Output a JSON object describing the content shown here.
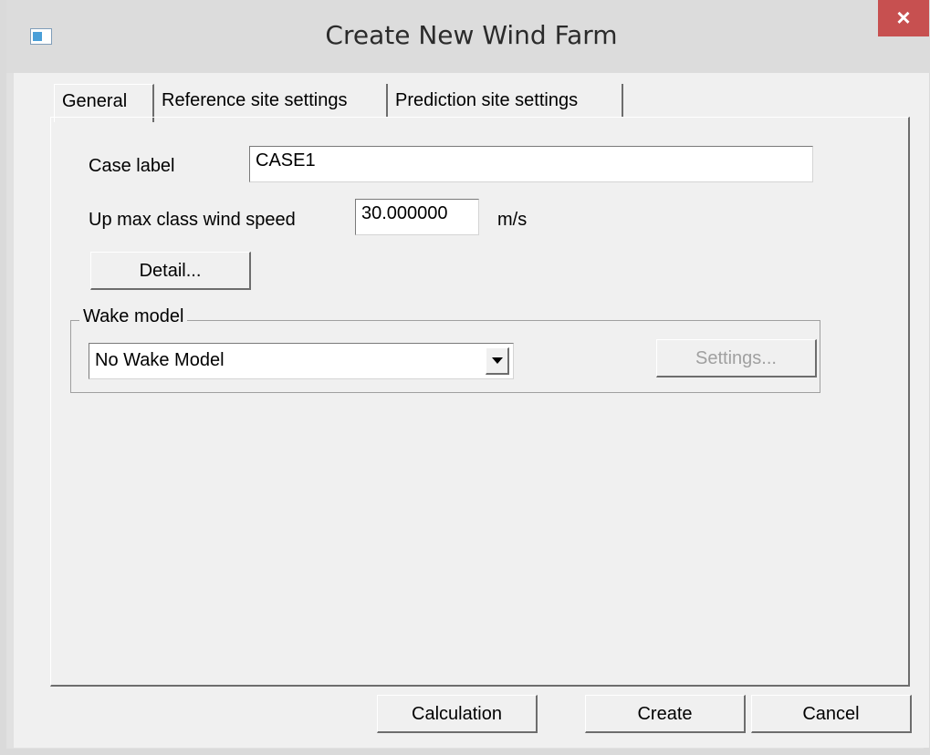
{
  "window": {
    "title": "Create New Wind Farm",
    "close_label": "×",
    "icon": "app-window-icon"
  },
  "tabs": [
    {
      "label": "General",
      "active": true
    },
    {
      "label": "Reference site settings",
      "active": false
    },
    {
      "label": "Prediction site settings",
      "active": false
    }
  ],
  "general": {
    "case_label": {
      "label": "Case label",
      "value": "CASE1"
    },
    "max_wind_speed": {
      "label": "Up max class wind speed",
      "value": "30.000000",
      "unit": "m/s"
    },
    "detail_button": "Detail...",
    "wake_model": {
      "group_title": "Wake model",
      "selected": "No Wake Model",
      "settings_button": "Settings...",
      "settings_enabled": false
    }
  },
  "footer": {
    "calculation_button": "Calculation",
    "create_button": "Create",
    "cancel_button": "Cancel"
  },
  "colors": {
    "close_button": "#c75050",
    "dialog_background": "#f0f0f0"
  }
}
